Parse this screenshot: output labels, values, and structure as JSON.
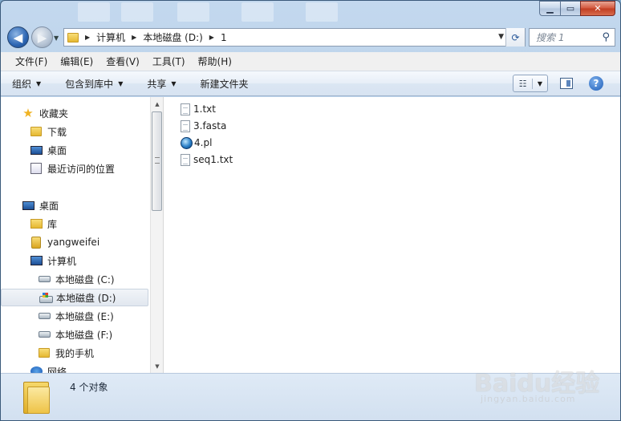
{
  "address": {
    "crumbs": [
      "计算机",
      "本地磁盘 (D:)",
      "1"
    ]
  },
  "search": {
    "placeholder": "搜索 1"
  },
  "menubar": [
    "文件(F)",
    "编辑(E)",
    "查看(V)",
    "工具(T)",
    "帮助(H)"
  ],
  "commandbar": {
    "organize": "组织",
    "include_library": "包含到库中",
    "share": "共享",
    "new_folder": "新建文件夹"
  },
  "navpane": {
    "favorites": "收藏夹",
    "downloads": "下载",
    "desktop_fav": "桌面",
    "recent": "最近访问的位置",
    "desktop": "桌面",
    "libraries": "库",
    "user": "yangweifei",
    "computer": "计算机",
    "drive_c": "本地磁盘 (C:)",
    "drive_d": "本地磁盘 (D:)",
    "drive_e": "本地磁盘 (E:)",
    "drive_f": "本地磁盘 (F:)",
    "phone": "我的手机",
    "network": "网络"
  },
  "files": [
    "1.txt",
    "3.fasta",
    "4.pl",
    "seq1.txt"
  ],
  "status": {
    "count": "4 个对象"
  },
  "watermark": {
    "brand": "Baidu经验",
    "url": "jingyan.baidu.com"
  },
  "colors": {
    "accent": "#2d66b3",
    "selection": "#e1e7ef"
  },
  "icons": {
    "back": "back-arrow-icon",
    "forward": "forward-arrow-icon",
    "search": "magnifier-icon",
    "help": "help-icon"
  }
}
